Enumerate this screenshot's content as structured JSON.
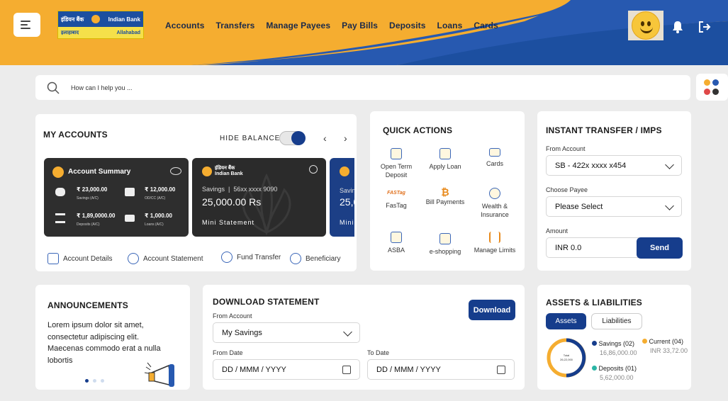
{
  "header": {
    "logo_hindi": "इंडियन बैंक",
    "logo_english": "Indian Bank",
    "logo_sub_hindi": "इलाहाबाद",
    "logo_sub_english": "Allahabad",
    "nav": [
      "Accounts",
      "Transfers",
      "Manage Payees",
      "Pay Bills",
      "Deposits",
      "Loans",
      "Cards"
    ],
    "icons": [
      "menu-icon",
      "bell-icon",
      "logout-icon"
    ],
    "colors": {
      "brand_yellow": "#f5ad30",
      "brand_blue": "#1c4fa0",
      "dark_blue": "#163d8c"
    }
  },
  "search": {
    "placeholder": "How can I help you ..."
  },
  "my_accounts": {
    "title": "MY ACCOUNTS",
    "hide_balance": "HIDE BALANCE",
    "summary": {
      "title": "Account Summary",
      "items": [
        {
          "amount": "₹ 23,000.00",
          "label": "Savings (A/C)"
        },
        {
          "amount": "₹ 12,000.00",
          "label": "OD/CC (A/C)"
        },
        {
          "amount": "₹ 1,89,0000.00",
          "label": "Deposits (A/C)"
        },
        {
          "amount": "₹ 1,000.00",
          "label": "Loans (A/C)"
        }
      ]
    },
    "savings_card": {
      "bank_hindi": "इंडियन बैंक",
      "bank_english": "Indian Bank",
      "type": "Savings",
      "number": "56xx xxxx 9090",
      "balance": "25,000.00 Rs",
      "action": "Mini Statement"
    },
    "partial_card": {
      "type": "Savin",
      "balance": "25,0",
      "action": "Mini"
    },
    "shortcuts": [
      "Account Details",
      "Account Statement",
      "Fund Transfer",
      "Beneficiary"
    ]
  },
  "quick_actions": {
    "title": "QUICK ACTIONS",
    "items": [
      "Open Term Deposit",
      "Apply Loan",
      "Cards",
      "FasTag",
      "Bill Payments",
      "Wealth & Insurance",
      "ASBA",
      "e-shopping",
      "Manage Limits"
    ],
    "fastag_logo": "FASTag"
  },
  "instant_transfer": {
    "title": "INSTANT TRANSFER / IMPS",
    "from_label": "From Account",
    "from_value": "SB  -  422x xxxx x454",
    "payee_label": "Choose Payee",
    "payee_value": "Please Select",
    "amount_label": "Amount",
    "amount_value": "INR 0.0",
    "send": "Send"
  },
  "announcements": {
    "title": "ANNOUNCEMENTS",
    "text": "Lorem ipsum dolor sit amet, consectetur adipiscing elit. Maecenas commodo erat a nulla lobortis"
  },
  "download_statement": {
    "title": "DOWNLOAD STATEMENT",
    "download": "Download",
    "from_account_label": "From Account",
    "from_account_value": "My Savings",
    "from_date_label": "From Date",
    "from_date_value": "DD / MMM / YYYY",
    "to_date_label": "To Date",
    "to_date_value": "DD / MMM / YYYY"
  },
  "assets": {
    "title": "ASSETS & LIABILITIES",
    "tabs": [
      "Assets",
      "Liabilities"
    ],
    "donut_center_label": "Total",
    "donut_center_value": "26,22,000",
    "legend": [
      {
        "name": "Savings (02)",
        "value": "16,86,000.00",
        "color": "#163d8c"
      },
      {
        "name": "Current (04)",
        "value": "INR 33,72.00",
        "color": "#f5ad30"
      },
      {
        "name": "Deposits (01)",
        "value": "5,62,000.00",
        "color": "#2bb5a5"
      }
    ]
  }
}
